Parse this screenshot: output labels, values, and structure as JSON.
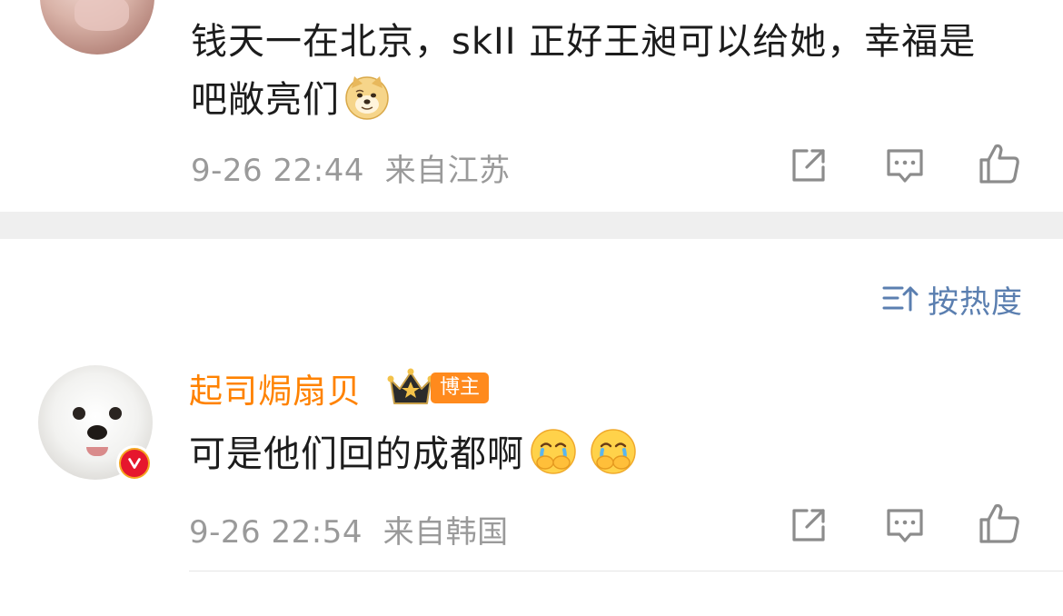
{
  "comments": [
    {
      "text": "钱天一在北京，skII 正好王昶可以给她，幸福是吧敞亮们",
      "emoji": "doge-emoji",
      "time": "9-26 22:44",
      "location": "来自江苏"
    },
    {
      "username": "起司焗扇贝",
      "author_badge": "博主",
      "verified_badge": "V",
      "text": "可是他们回的成都啊",
      "emojis": [
        "crying-face-emoji",
        "crying-face-emoji"
      ],
      "time": "9-26 22:54",
      "location": "来自韩国"
    }
  ],
  "sort": {
    "label": "按热度",
    "icon": "sort-icon"
  },
  "actions": [
    "share-icon",
    "comment-icon",
    "like-icon"
  ],
  "colors": {
    "username": "#ff8200",
    "sort_label": "#5b7fb0",
    "meta_text": "#9a9a9a",
    "separator": "#efefef",
    "author_badge_bg": "#ff8a1d"
  }
}
